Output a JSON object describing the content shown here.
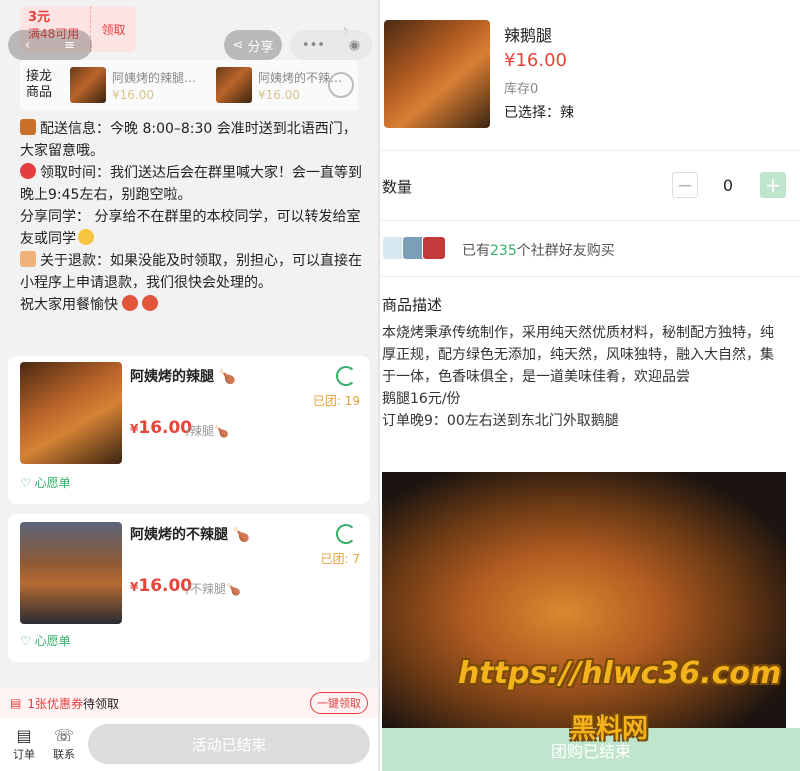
{
  "left": {
    "coupon": {
      "amount": "3元",
      "condition": "满48可用",
      "claim": "领取"
    },
    "nav": {
      "share": "分享"
    },
    "chain": {
      "label": "接龙商品",
      "items": [
        {
          "name": "阿姨烤的辣腿…",
          "price": "¥16.00"
        },
        {
          "name": "阿姨烤的不辣…",
          "price": "¥16.00"
        }
      ]
    },
    "notice": [
      "配送信息：今晚 8:00–8:30 会准时送到北语西门，大家留意哦。",
      "领取时间：我们送达后会在群里喊大家！会一直等到晚上9:45左右，别跑空啦。",
      "分享同学： 分享给不在群里的本校同学，可以转发给室友或同学",
      "关于退款：如果没能及时领取，别担心，可以直接在小程序上申请退款，我们很快会处理的。",
      "祝大家用餐愉快"
    ],
    "products": [
      {
        "name": "阿姨烤的辣腿",
        "price": "16.00",
        "currency": "¥",
        "spec": "/辣腿",
        "joined": "已团: 19",
        "wish": "心愿单"
      },
      {
        "name": "阿姨烤的不辣腿",
        "price": "16.00",
        "currency": "¥",
        "spec": "/不辣腿",
        "joined": "已团: 7",
        "wish": "心愿单"
      }
    ],
    "coupon_bar": {
      "count": "1张优惠券",
      "text": "待领取",
      "button": "一键领取"
    },
    "bottom": {
      "order": "订单",
      "contact": "联系",
      "ended": "活动已结束"
    }
  },
  "right": {
    "title": "辣鹅腿",
    "price": "¥16.00",
    "stock": "库存0",
    "selected": "已选择：辣",
    "qty_label": "数量",
    "qty": "0",
    "buyers_prefix": "已有",
    "buyers_count": "235",
    "buyers_suffix": "个社群好友购买",
    "desc_title": "商品描述",
    "desc_lines": [
      "本烧烤秉承传统制作，采用纯天然优质材料，秘制配方独特，纯厚正规，配方绿色无添加，纯天然，风味独特，融入大自然，集于一体，色香味俱全，是一道美味佳肴，欢迎品尝",
      "鹅腿16元/份",
      "订单晚9：00左右送到东北门外取鹅腿"
    ],
    "button": "团购已结束"
  },
  "watermark": {
    "url": "https://hlwc36.com",
    "site": "黑料网"
  },
  "colors": {
    "green": "#35b06a",
    "red": "#e8443a",
    "light_green": "#bfe6cd"
  }
}
